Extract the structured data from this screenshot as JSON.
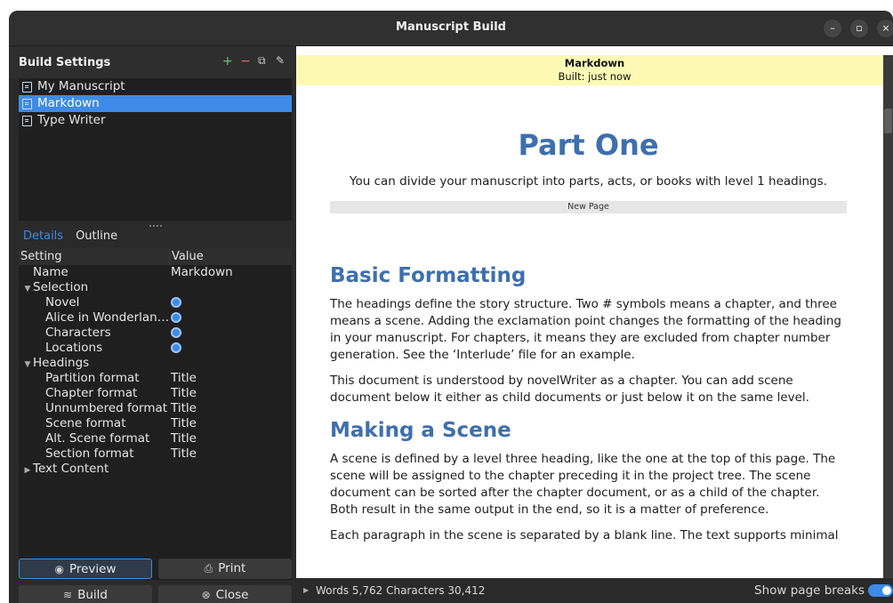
{
  "window": {
    "title": "Manuscript Build"
  },
  "build_settings": {
    "header": "Build Settings",
    "items": [
      {
        "label": "My Manuscript"
      },
      {
        "label": "Markdown",
        "selected": true
      },
      {
        "label": "Type Writer"
      }
    ]
  },
  "tabs": {
    "details": "Details",
    "outline": "Outline"
  },
  "tree": {
    "col_setting": "Setting",
    "col_value": "Value",
    "name_key": "Name",
    "name_value": "Markdown",
    "selection": "Selection",
    "novel": "Novel",
    "alice": "Alice in Wonderlan…",
    "characters": "Characters",
    "locations": "Locations",
    "headings": "Headings",
    "partition": "Partition format",
    "chapter": "Chapter format",
    "unnumbered": "Unnumbered format",
    "scene": "Scene format",
    "alt_scene": "Alt. Scene format",
    "section": "Section format",
    "title_value": "Title",
    "text_content": "Text Content"
  },
  "buttons": {
    "preview": "Preview",
    "print": "Print",
    "build": "Build",
    "close": "Close"
  },
  "banner": {
    "title": "Markdown",
    "subtitle": "Built: just now"
  },
  "document": {
    "part_title": "Part One",
    "part_text": "You can divide your manuscript into parts, acts, or books with level 1 headings.",
    "new_page": "New Page",
    "h_basic": "Basic Formatting",
    "p1": "The headings define the story structure. Two # symbols means a chapter, and three means a scene. Adding the exclamation point changes the formatting of the heading in your manuscript. For chapters, it means they are excluded from chapter number generation. See the ‘Interlude’ file for an example.",
    "p2": "This document is understood by novelWriter as a chapter. You can add scene document below it either as child documents or just below it on the same level.",
    "h_scene": "Making a Scene",
    "p3": "A scene is defined by a level three heading, like the one at the top of this page. The scene will be assigned to the chapter preceding it in the project tree. The scene document can be sorted after the chapter document, or as a child of the chapter. Both result in the same output in the end, so it is a matter of preference.",
    "p4": "Each paragraph in the scene is separated by a blank line. The text supports minimal"
  },
  "status": {
    "stats": "Words 5,762   Characters 30,412",
    "page_breaks": "Show page breaks",
    "page_breaks_on": true
  },
  "colors": {
    "accent": "#3d8be6",
    "heading": "#3e6fad",
    "banner": "#fdf9b5"
  }
}
